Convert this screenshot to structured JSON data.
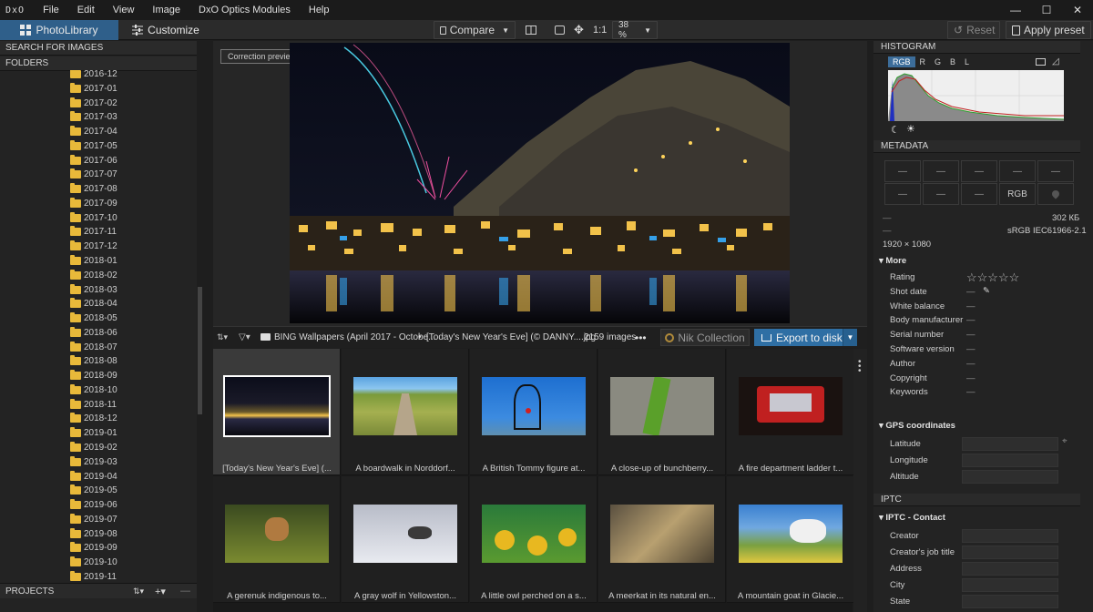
{
  "menubar": {
    "logo": "DxO",
    "items": [
      "File",
      "Edit",
      "View",
      "Image",
      "DxO Optics Modules",
      "Help"
    ]
  },
  "toolbar": {
    "photolibrary": "PhotoLibrary",
    "customize": "Customize",
    "compare": "Compare",
    "one_to_one": "1:1",
    "zoom": "38 %",
    "reset": "Reset",
    "apply_preset": "Apply preset"
  },
  "left": {
    "search": "SEARCH FOR IMAGES",
    "folders": "FOLDERS",
    "folder_items": [
      "2016-12",
      "2017-01",
      "2017-02",
      "2017-03",
      "2017-04",
      "2017-05",
      "2017-06",
      "2017-07",
      "2017-08",
      "2017-09",
      "2017-10",
      "2017-11",
      "2017-12",
      "2018-01",
      "2018-02",
      "2018-03",
      "2018-04",
      "2018-05",
      "2018-06",
      "2018-07",
      "2018-08",
      "2018-09",
      "2018-10",
      "2018-11",
      "2018-12",
      "2019-01",
      "2019-02",
      "2019-03",
      "2019-04",
      "2019-05",
      "2019-06",
      "2019-07",
      "2019-08",
      "2019-09",
      "2019-10",
      "2019-11"
    ],
    "projects": "PROJECTS"
  },
  "viewer": {
    "correction_preview": "Correction preview"
  },
  "filmbar": {
    "folder_name": "BING Wallpapers (April 2017 - Octobe...",
    "file_name": "[Today's New Year's Eve] (© DANNY....jpg",
    "count": "2159 images",
    "nik": "Nik Collection",
    "export": "Export to disk"
  },
  "grid": {
    "captions": [
      "[Today's New Year's Eve] (...",
      "A boardwalk in Norddorf...",
      "A British Tommy figure at...",
      "A close-up of bunchberry...",
      "A fire department ladder t...",
      "A gerenuk indigenous to...",
      "A gray wolf in Yellowston...",
      "A little owl perched on a s...",
      "A meerkat in its natural en...",
      "A mountain goat in Glacie..."
    ]
  },
  "right": {
    "histogram": "HISTOGRAM",
    "hist_tabs": [
      "RGB",
      "R",
      "G",
      "B",
      "L"
    ],
    "metadata": "METADATA",
    "meta_cells": [
      "—",
      "—",
      "—",
      "—",
      "—",
      "—",
      "—",
      "—",
      "RGB",
      ""
    ],
    "dash": "—",
    "file_size": "302 КБ",
    "color_space": "sRGB IEC61966-2.1",
    "dimensions": "1920 × 1080",
    "more": "More",
    "more_fields": [
      {
        "label": "Rating",
        "value": "☆☆☆☆☆"
      },
      {
        "label": "Shot date",
        "value": "—"
      },
      {
        "label": "White balance",
        "value": "—"
      },
      {
        "label": "Body manufacturer",
        "value": "—"
      },
      {
        "label": "Serial number",
        "value": "—"
      },
      {
        "label": "Software version",
        "value": "—"
      },
      {
        "label": "Author",
        "value": "—"
      },
      {
        "label": "Copyright",
        "value": "—"
      },
      {
        "label": "Keywords",
        "value": "—"
      }
    ],
    "gps": "GPS coordinates",
    "gps_fields": [
      "Latitude",
      "Longitude",
      "Altitude"
    ],
    "iptc": "IPTC",
    "iptc_contact": "IPTC - Contact",
    "iptc_fields": [
      "Creator",
      "Creator's job title",
      "Address",
      "City",
      "State"
    ]
  },
  "colors": {
    "accent": "#2f6fa4",
    "tab_active": "#2f5f8a",
    "folder": "#e8b93a"
  },
  "icons": [
    "compare-icon",
    "split-view-icon",
    "crop-icon",
    "move-icon",
    "reset-icon",
    "apply-preset-icon",
    "filter-icon",
    "sort-icon",
    "folder-icon",
    "more-icon",
    "nik-icon",
    "export-icon",
    "moon-icon",
    "sun-icon",
    "monitor-icon",
    "gps-icon",
    "pencil-icon"
  ]
}
